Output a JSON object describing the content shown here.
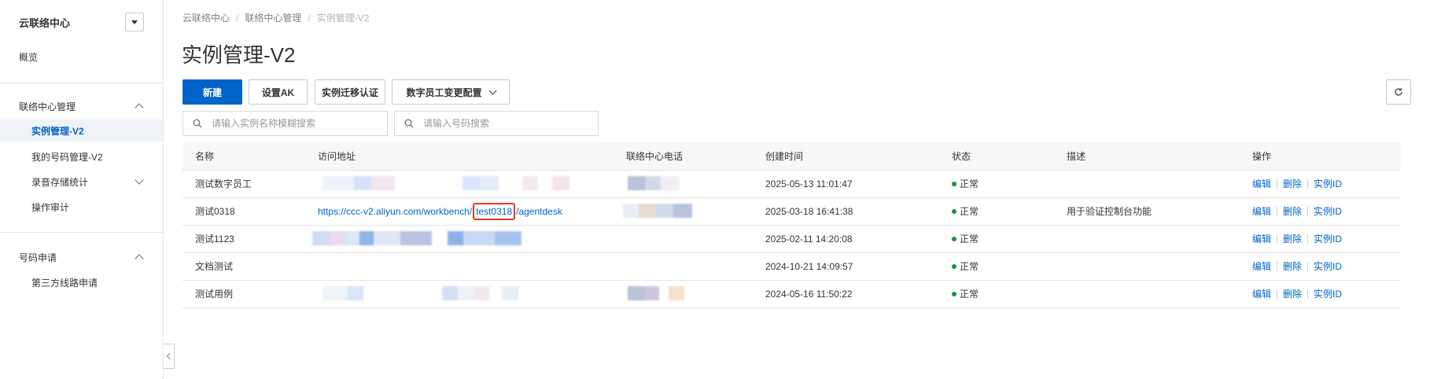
{
  "sidebar": {
    "title": "云联络中心",
    "overview": "概览",
    "groups": [
      {
        "label": "联络中心管理",
        "items": [
          "实例管理-V2",
          "我的号码管理-V2",
          "录音存储统计",
          "操作审计"
        ]
      },
      {
        "label": "号码申请",
        "items": [
          "第三方线路申请"
        ]
      }
    ],
    "active_item": "实例管理-V2"
  },
  "breadcrumb": [
    "云联络中心",
    "联络中心管理",
    "实例管理-V2"
  ],
  "page_title": "实例管理-V2",
  "toolbar": {
    "new_label": "新建",
    "set_ak_label": "设置AK",
    "migrate_label": "实例迁移认证",
    "digital_config_label": "数字员工变更配置"
  },
  "search": {
    "instance_placeholder": "请输入实例名称模糊搜索",
    "number_placeholder": "请输入号码搜索"
  },
  "table": {
    "columns": [
      "名称",
      "访问地址",
      "联络中心电话",
      "创建时间",
      "状态",
      "描述",
      "操作"
    ],
    "rows": [
      {
        "name": "测试数字员工",
        "url": "",
        "phone": "",
        "created": "2025-05-13 11:01:47",
        "status": "正常",
        "desc": ""
      },
      {
        "name": "测试0318",
        "url_prefix": "https://ccc-v2.aliyun.com/workbench/",
        "url_highlight": "test0318",
        "url_suffix": "/agentdesk",
        "phone": "",
        "created": "2025-03-18 16:41:38",
        "status": "正常",
        "desc": "用于验证控制台功能"
      },
      {
        "name": "测试1123",
        "url": "",
        "phone": "",
        "created": "2025-02-11 14:20:08",
        "status": "正常",
        "desc": ""
      },
      {
        "name": "文档测试",
        "url": "",
        "phone": "",
        "created": "2024-10-21 14:09:57",
        "status": "正常",
        "desc": ""
      },
      {
        "name": "测试用例",
        "url": "",
        "phone": "",
        "created": "2024-05-16 11:50:22",
        "status": "正常",
        "desc": ""
      }
    ],
    "ops": {
      "edit": "编辑",
      "delete": "删除",
      "instance_id": "实例ID"
    }
  },
  "colors": {
    "primary": "#0064c8",
    "status_ok": "#1e8e3e",
    "highlight_box": "#e0392c",
    "active_bg": "#eff3f8"
  }
}
